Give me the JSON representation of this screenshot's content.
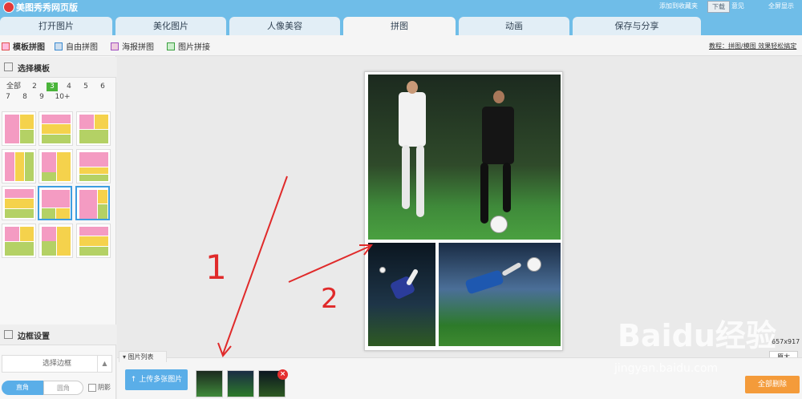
{
  "app": {
    "title": "美图秀秀网页版",
    "download_label": "下载",
    "links": [
      "添加到收藏夹",
      "意见",
      "全屏显示"
    ]
  },
  "tabs": [
    "打开图片",
    "美化图片",
    "人像美容",
    "拼图",
    "动画",
    "保存与分享"
  ],
  "active_tab": 3,
  "subtoolbar": {
    "items": [
      "模板拼图",
      "自由拼图",
      "海报拼图",
      "图片拼接"
    ],
    "tip": "教程：拼图/模图 效果轻松搞定"
  },
  "left_panel": {
    "template_header": "选择模板",
    "counts": [
      "全部",
      "2",
      "3",
      "4",
      "5",
      "6",
      "7",
      "8",
      "9",
      "10+"
    ],
    "active_count": "3",
    "border_header": "边框设置",
    "border_select": "选择边框",
    "toggle_square": "直角",
    "toggle_round": "圆角",
    "shadow_label": "阴影"
  },
  "canvas": {
    "size_text": "657x917",
    "zoom_label": "原大"
  },
  "bottom": {
    "list_label": "图片列表",
    "upload_label": "上传多张图片",
    "clear_label": "全部删除"
  },
  "annotations": {
    "label1": "1",
    "label2": "2"
  },
  "watermark": {
    "logo": "Baidu经验",
    "url": "jingyan.baidu.com"
  },
  "colors": {
    "accent": "#6fbde8",
    "tile_pink": "#f49bc2",
    "tile_yellow": "#f5d24c",
    "tile_green": "#b4d165",
    "annotation_red": "#e02a2a",
    "active_count": "#4ab43a"
  }
}
